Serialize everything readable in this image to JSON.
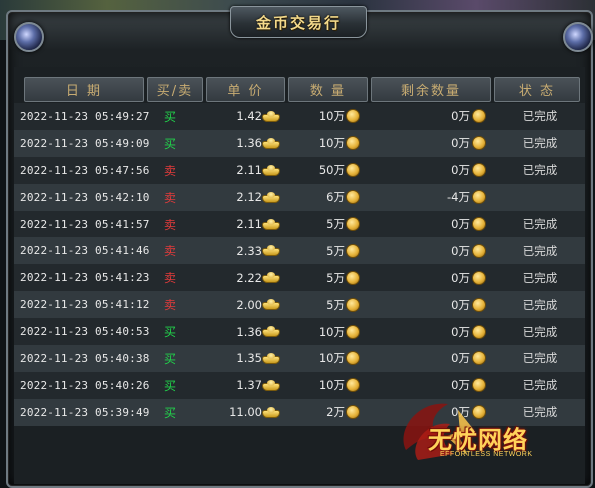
{
  "window": {
    "title": "金币交易行"
  },
  "table": {
    "headers": [
      "日 期",
      "买/卖",
      "单 价",
      "数 量",
      "剩余数量",
      "状 态"
    ],
    "rows": [
      {
        "date": "2022-11-23 05:49:27",
        "type": "买",
        "side": "buy",
        "price": "1.42",
        "qty": "10万",
        "remaining": "0万",
        "status": "已完成"
      },
      {
        "date": "2022-11-23 05:49:09",
        "type": "买",
        "side": "buy",
        "price": "1.36",
        "qty": "10万",
        "remaining": "0万",
        "status": "已完成"
      },
      {
        "date": "2022-11-23 05:47:56",
        "type": "卖",
        "side": "sell",
        "price": "2.11",
        "qty": "50万",
        "remaining": "0万",
        "status": "已完成"
      },
      {
        "date": "2022-11-23 05:42:10",
        "type": "卖",
        "side": "sell",
        "price": "2.12",
        "qty": "6万",
        "remaining": "-4万",
        "status": ""
      },
      {
        "date": "2022-11-23 05:41:57",
        "type": "卖",
        "side": "sell",
        "price": "2.11",
        "qty": "5万",
        "remaining": "0万",
        "status": "已完成"
      },
      {
        "date": "2022-11-23 05:41:46",
        "type": "卖",
        "side": "sell",
        "price": "2.33",
        "qty": "5万",
        "remaining": "0万",
        "status": "已完成"
      },
      {
        "date": "2022-11-23 05:41:23",
        "type": "卖",
        "side": "sell",
        "price": "2.22",
        "qty": "5万",
        "remaining": "0万",
        "status": "已完成"
      },
      {
        "date": "2022-11-23 05:41:12",
        "type": "卖",
        "side": "sell",
        "price": "2.00",
        "qty": "5万",
        "remaining": "0万",
        "status": "已完成"
      },
      {
        "date": "2022-11-23 05:40:53",
        "type": "买",
        "side": "buy",
        "price": "1.36",
        "qty": "10万",
        "remaining": "0万",
        "status": "已完成"
      },
      {
        "date": "2022-11-23 05:40:38",
        "type": "买",
        "side": "buy",
        "price": "1.35",
        "qty": "10万",
        "remaining": "0万",
        "status": "已完成"
      },
      {
        "date": "2022-11-23 05:40:26",
        "type": "买",
        "side": "buy",
        "price": "1.37",
        "qty": "10万",
        "remaining": "0万",
        "status": "已完成"
      },
      {
        "date": "2022-11-23 05:39:49",
        "type": "买",
        "side": "buy",
        "price": "11.00",
        "qty": "2万",
        "remaining": "0万",
        "status": "已完成"
      }
    ]
  },
  "icons": {
    "price": "gold-ingot-icon",
    "qty": "gold-coin-icon",
    "remaining": "gold-coin-icon",
    "window_corners": "orb-ornament-icon"
  },
  "colors": {
    "buy": "#21d64b",
    "sell": "#e23b3b",
    "header_text": "#c8ac72",
    "title_text": "#f3d98a"
  },
  "watermark": {
    "text": "无忧网络",
    "subtext": "EFFORTLESS NETWORK"
  }
}
